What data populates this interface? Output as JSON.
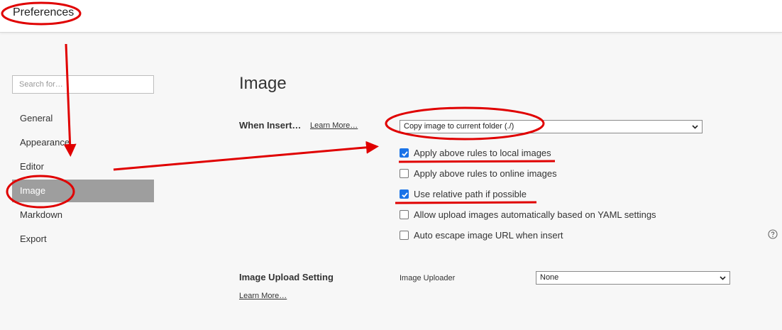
{
  "window": {
    "title": "Preferences"
  },
  "sidebar": {
    "search_placeholder": "Search for…",
    "items": [
      {
        "label": "General"
      },
      {
        "label": "Appearance"
      },
      {
        "label": "Editor"
      },
      {
        "label": "Image",
        "active": true
      },
      {
        "label": "Markdown"
      },
      {
        "label": "Export"
      }
    ]
  },
  "main": {
    "title": "Image",
    "when_insert": {
      "label": "When Insert…",
      "learn_more": "Learn More…",
      "selected_option": "Copy image to current folder (./)"
    },
    "options": [
      {
        "label": "Apply above rules to local images",
        "checked": true
      },
      {
        "label": "Apply above rules to online images",
        "checked": false
      },
      {
        "label": "Use relative path if possible",
        "checked": true
      },
      {
        "label": "Allow upload images automatically based on YAML settings",
        "checked": false
      },
      {
        "label": "Auto escape image URL when insert",
        "checked": false
      }
    ],
    "help_icon": "question-circle-icon",
    "upload": {
      "label": "Image Upload Setting",
      "learn_more": "Learn More…",
      "uploader_label": "Image Uploader",
      "uploader_value": "None"
    }
  },
  "annotations": {
    "color": "#e00000"
  },
  "colors": {
    "checkbox": "#1a73e8",
    "active_nav": "#9e9e9e"
  }
}
